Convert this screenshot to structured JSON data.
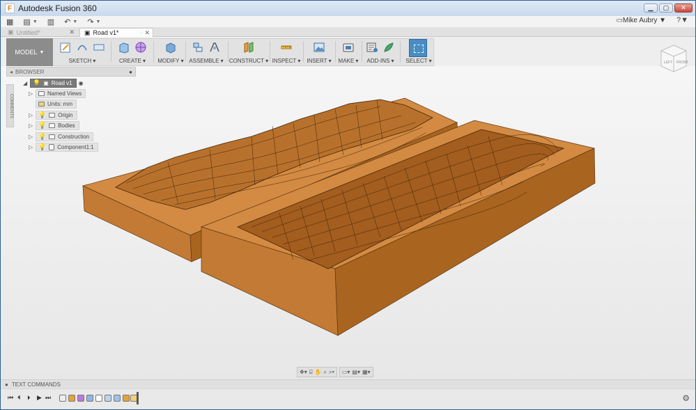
{
  "window": {
    "title": "Autodesk Fusion 360",
    "app_icon": "F",
    "minimize": "▁",
    "maximize": "▢",
    "close": "✕"
  },
  "qat": {
    "grid_icon": "▦",
    "file_icon": "▤",
    "save_icon": "▥",
    "undo_icon": "↶",
    "redo_icon": "↷",
    "caret": "▼",
    "comment_icon": "▭",
    "user": "Mike Aubry ▼",
    "help": "?▼"
  },
  "tabs": [
    {
      "label": "Untitled*",
      "active": false
    },
    {
      "label": "Road v1*",
      "active": true
    }
  ],
  "ribbon": {
    "workspace": "MODEL",
    "groups": [
      "SKETCH",
      "CREATE",
      "MODIFY",
      "ASSEMBLE",
      "CONSTRUCT",
      "INSPECT",
      "INSERT",
      "MAKE",
      "ADD-INS",
      "SELECT"
    ]
  },
  "viewcube": {
    "left": "LEFT",
    "front": "FRONT"
  },
  "browser": {
    "title": "BROWSER",
    "comments": "COMMENTS",
    "items": [
      {
        "label": "Road v1"
      },
      {
        "label": "Named Views"
      },
      {
        "label": "Units: mm"
      },
      {
        "label": "Origin"
      },
      {
        "label": "Bodies"
      },
      {
        "label": "Construction"
      },
      {
        "label": "Component1:1"
      }
    ]
  },
  "text_commands": "TEXT COMMANDS",
  "colors": {
    "model_fill": "#c87a33",
    "model_dark": "#a85f22",
    "model_light": "#e09a55",
    "select_accent": "#4b8cc2",
    "titlebar": "#c9d9ec"
  }
}
